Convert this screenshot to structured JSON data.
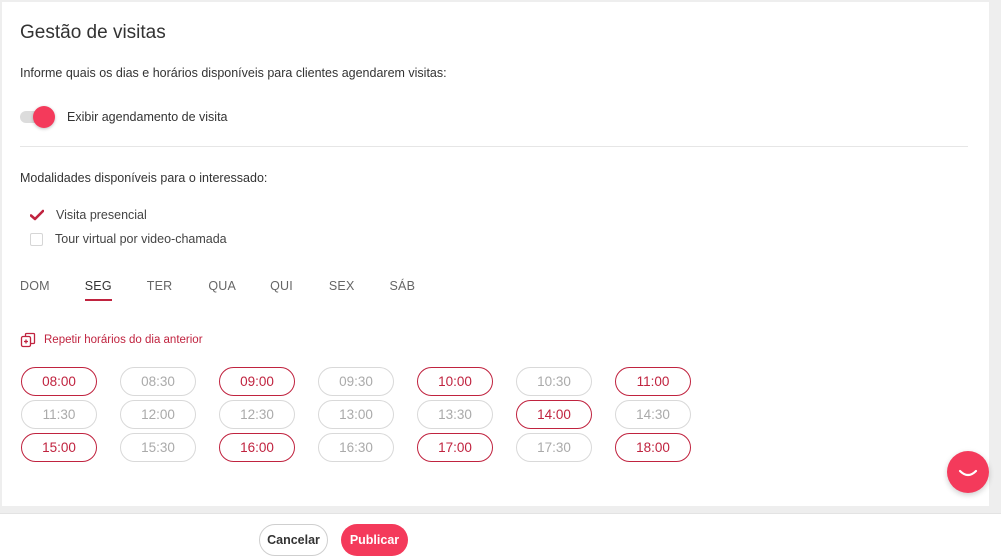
{
  "title": "Gestão de visitas",
  "subtitle": "Informe quais os dias e horários disponíveis para clientes agendarem visitas:",
  "toggle": {
    "label": "Exibir agendamento de visita",
    "on": true
  },
  "modalities": {
    "title": "Modalidades disponíveis para o interessado:",
    "options": [
      {
        "label": "Visita presencial",
        "checked": true
      },
      {
        "label": "Tour virtual por video-chamada",
        "checked": false
      }
    ]
  },
  "days": [
    "DOM",
    "SEG",
    "TER",
    "QUA",
    "QUI",
    "SEX",
    "SÁB"
  ],
  "active_day": "SEG",
  "repeat_label": "Repetir horários do dia anterior",
  "slots": [
    {
      "time": "08:00",
      "selected": true
    },
    {
      "time": "08:30",
      "selected": false
    },
    {
      "time": "09:00",
      "selected": true
    },
    {
      "time": "09:30",
      "selected": false
    },
    {
      "time": "10:00",
      "selected": true
    },
    {
      "time": "10:30",
      "selected": false
    },
    {
      "time": "11:00",
      "selected": true
    },
    {
      "time": "11:30",
      "selected": false
    },
    {
      "time": "12:00",
      "selected": false
    },
    {
      "time": "12:30",
      "selected": false
    },
    {
      "time": "13:00",
      "selected": false
    },
    {
      "time": "13:30",
      "selected": false
    },
    {
      "time": "14:00",
      "selected": true
    },
    {
      "time": "14:30",
      "selected": false
    },
    {
      "time": "15:00",
      "selected": true
    },
    {
      "time": "15:30",
      "selected": false
    },
    {
      "time": "16:00",
      "selected": true
    },
    {
      "time": "16:30",
      "selected": false
    },
    {
      "time": "17:00",
      "selected": true
    },
    {
      "time": "17:30",
      "selected": false
    },
    {
      "time": "18:00",
      "selected": true
    }
  ],
  "footer": {
    "cancel_label": "Cancelar",
    "publish_label": "Publicar"
  },
  "colors": {
    "accent": "#f43a5b",
    "accent_dark": "#c0233f"
  }
}
